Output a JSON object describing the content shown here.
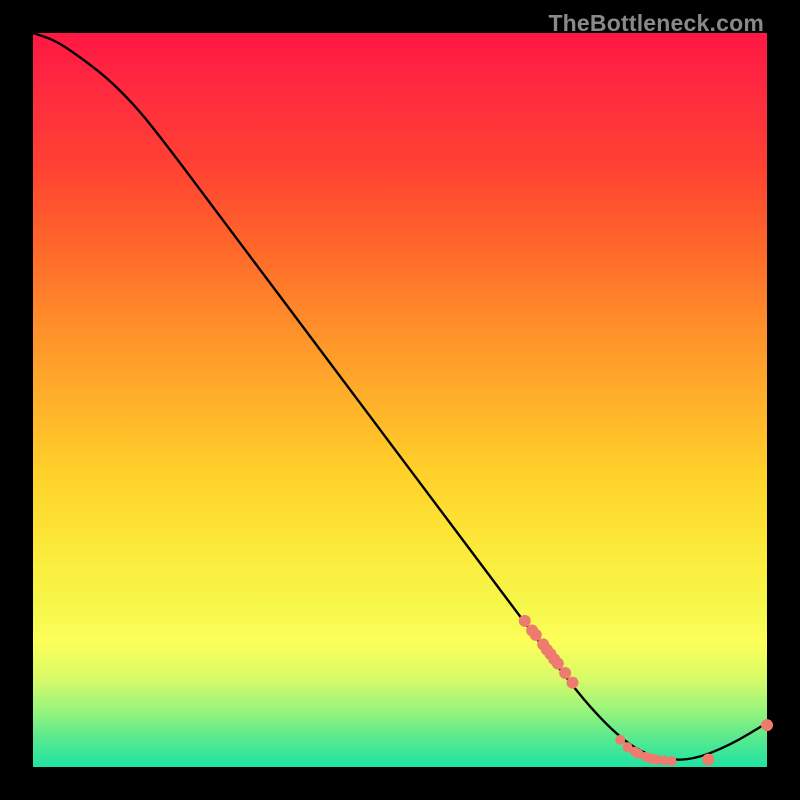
{
  "watermark": "TheBottleneck.com",
  "chart_data": {
    "type": "line",
    "title": "",
    "xlabel": "",
    "ylabel": "",
    "xlim": [
      0,
      100
    ],
    "ylim": [
      0,
      100
    ],
    "grid": false,
    "legend": false,
    "series": [
      {
        "name": "bottleneck-curve",
        "x": [
          0,
          3,
          6,
          10,
          14,
          18,
          24,
          30,
          36,
          42,
          48,
          54,
          60,
          66,
          72,
          76,
          80,
          83,
          86,
          90,
          95,
          100
        ],
        "y": [
          100,
          99,
          97,
          94,
          90,
          85,
          77,
          69,
          61,
          53,
          45,
          37,
          29,
          21,
          13,
          8,
          4,
          2,
          1,
          1,
          3,
          6
        ]
      }
    ],
    "marker_points": {
      "name": "highlighted-points",
      "color": "#ed7c6f",
      "x": [
        67,
        68,
        68.5,
        69.5,
        70,
        70.5,
        71,
        71.5,
        72.5,
        73.5,
        80,
        81,
        82,
        82.5,
        83.5,
        84,
        84.5,
        85,
        86,
        87,
        92,
        100
      ],
      "y": [
        19.9,
        18.6,
        18.0,
        16.7,
        16.0,
        15.4,
        14.7,
        14.1,
        12.8,
        11.5,
        3.7,
        2.7,
        2.1,
        1.8,
        1.4,
        1.2,
        1.1,
        1.0,
        0.9,
        0.8,
        1.0,
        5.7
      ],
      "r": [
        6,
        6,
        6,
        6,
        6,
        6,
        6,
        6,
        6,
        6,
        5,
        5,
        5,
        5,
        5,
        5,
        5,
        5,
        5,
        5,
        6,
        6
      ]
    }
  }
}
